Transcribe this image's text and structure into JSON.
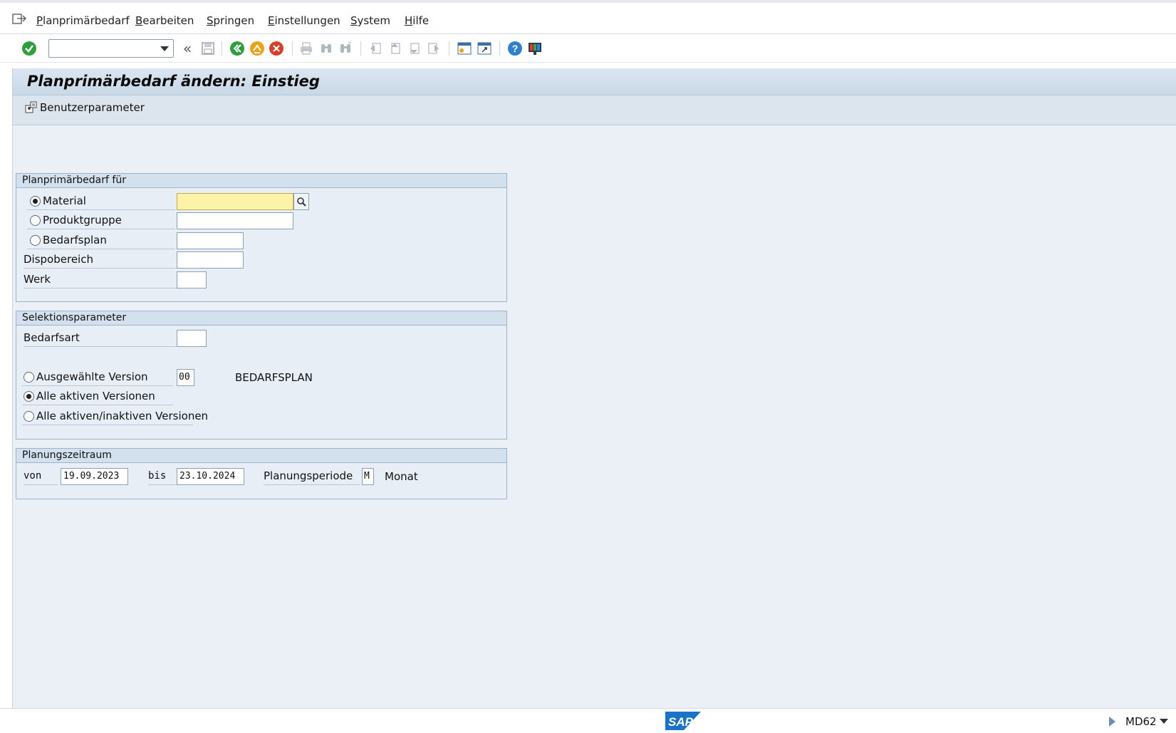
{
  "menu": {
    "items": [
      "Planprimärbedarf",
      "Bearbeiten",
      "Springen",
      "Einstellungen",
      "System",
      "Hilfe"
    ]
  },
  "toolbar": {
    "command_value": ""
  },
  "title": "Planprimärbedarf ändern: Einstieg",
  "app_toolbar": {
    "user_params_label": "Benutzerparameter"
  },
  "group_for": {
    "header": "Planprimärbedarf für",
    "material_label": "Material",
    "material_value": "",
    "produktgruppe_label": "Produktgruppe",
    "produktgruppe_value": "",
    "bedarfsplan_label": "Bedarfsplan",
    "bedarfsplan_value": "",
    "dispobereich_label": "Dispobereich",
    "dispobereich_value": "",
    "werk_label": "Werk",
    "werk_value": "",
    "selected_radio": "Material"
  },
  "group_selection": {
    "header": "Selektionsparameter",
    "bedarfsart_label": "Bedarfsart",
    "bedarfsart_value": "",
    "version_label": "Ausgewählte Version",
    "version_value": "00",
    "version_text": "BEDARFSPLAN",
    "all_active_label": "Alle aktiven Versionen",
    "all_active_inactive_label": "Alle aktiven/inaktiven Versionen",
    "selected_radio": "Alle aktiven Versionen"
  },
  "group_period": {
    "header": "Planungszeitraum",
    "von_label": "von",
    "von_value": "19.09.2023",
    "bis_label": "bis",
    "bis_value": "23.10.2024",
    "periode_label": "Planungsperiode",
    "periode_value": "M",
    "periode_text": "Monat"
  },
  "status": {
    "logo_text": "SAP",
    "tcode": "MD62"
  },
  "colors": {
    "accent_green": "#2e9e3f",
    "accent_orange": "#e8a21b",
    "accent_red": "#d6402b",
    "focus_field": "#fdf3a8"
  }
}
